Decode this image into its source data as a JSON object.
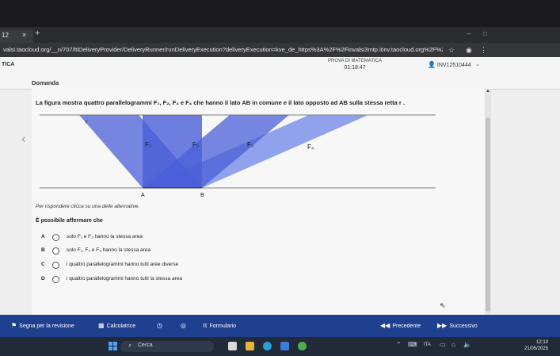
{
  "browser": {
    "tab_label": "12",
    "tab_close": "×",
    "new_tab": "+",
    "url": "valsi.taocloud.org/__n/707/ltiDeliveryProvider/DeliveryRunner/runDeliveryExecution?deliveryExecution=kve_de_https%3A%2F%2Finvalsi3mtp.itinv.taocloud.org%2F%2..."
  },
  "header": {
    "subject": "TICA",
    "test_title": "PROVA DI MATEMATICA",
    "timer": "01:18:47",
    "user_code": "INV12510444",
    "section_label": "Domanda"
  },
  "question": {
    "stem": "La figura mostra quattro parallelogrammi F₁, F₂, F₃ e F₄ che hanno il lato AB in comune e il lato opposto ad AB sulla stessa retta r .",
    "instruction": "Per rispondere clicca su una delle alternative.",
    "prompt": "È possibile affermare che",
    "options": [
      {
        "letter": "A",
        "text": "solo F₁ e F₃ hanno la stessa area"
      },
      {
        "letter": "B",
        "text": "solo F₁, F₂ e F₃ hanno la stessa area"
      },
      {
        "letter": "C",
        "text": "i quattro parallelogrammi hanno tutti aree diverse"
      },
      {
        "letter": "D",
        "text": "i quattro parallelogrammi hanno tutti la stessa area"
      }
    ],
    "figure_labels": {
      "r": "r",
      "F1": "F₁",
      "F2": "F₂",
      "F3": "F₃",
      "F4": "F₄",
      "A": "A",
      "B": "B"
    }
  },
  "toolbar": {
    "review": "Segna per la revisione",
    "calculator": "Calcolatrice",
    "formulas": "Formulario",
    "previous": "Precedente",
    "next": "Successivo"
  },
  "taskbar": {
    "search": "Cerca",
    "language": "ITA",
    "time": "12:10",
    "date": "21/05/2025"
  },
  "colors": {
    "toolbar_bg": "#1f3f8f",
    "shape_fill": "#4a5fd8",
    "shape_fill_light": "#6f86e8"
  }
}
